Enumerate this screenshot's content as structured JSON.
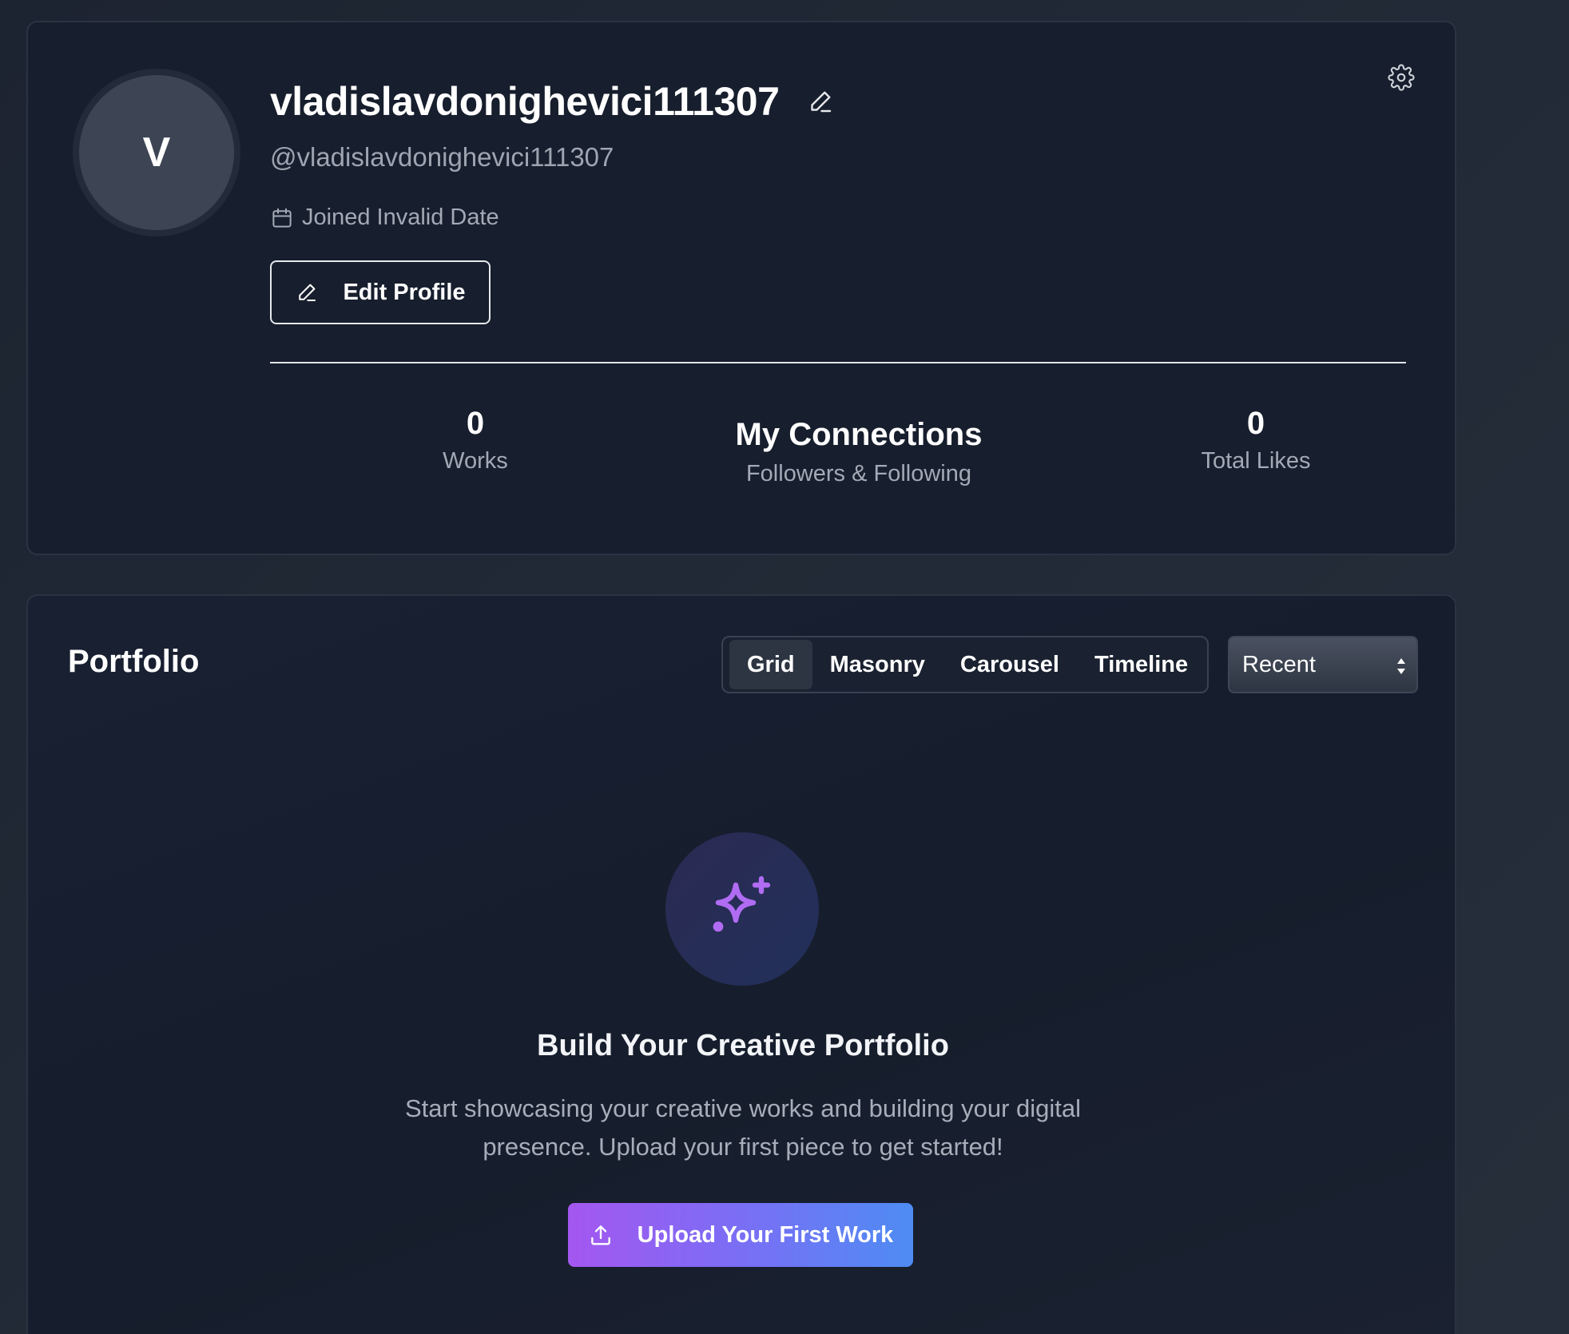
{
  "profile": {
    "avatar_initial": "V",
    "display_name": "vladislavdonighevici111307",
    "handle": "@vladislavdonighevici111307",
    "joined_text": "Joined Invalid Date",
    "edit_profile_label": "Edit Profile",
    "icons": {
      "edit_name": "pencil-icon",
      "settings": "gear-icon",
      "joined": "calendar-icon",
      "edit_profile": "pencil-icon"
    }
  },
  "stats": {
    "works": {
      "value": "0",
      "label": "Works"
    },
    "connections": {
      "title": "My Connections",
      "label": "Followers & Following"
    },
    "likes": {
      "value": "0",
      "label": "Total Likes"
    }
  },
  "portfolio": {
    "title": "Portfolio",
    "view_tabs": [
      {
        "label": "Grid",
        "active": true
      },
      {
        "label": "Masonry",
        "active": false
      },
      {
        "label": "Carousel",
        "active": false
      },
      {
        "label": "Timeline",
        "active": false
      }
    ],
    "sort": {
      "selected": "Recent"
    },
    "empty_state": {
      "icon": "sparkles-icon",
      "title": "Build Your Creative Portfolio",
      "description": "Start showcasing your creative works and building your digital presence. Upload your first piece to get started!",
      "cta_label": "Upload Your First Work",
      "cta_icon": "upload-icon"
    }
  },
  "colors": {
    "background": "#222936",
    "card": "#171e2d",
    "accent_purple": "#a457f0",
    "accent_blue": "#4e8cf3",
    "muted_text": "#a3aab6"
  }
}
